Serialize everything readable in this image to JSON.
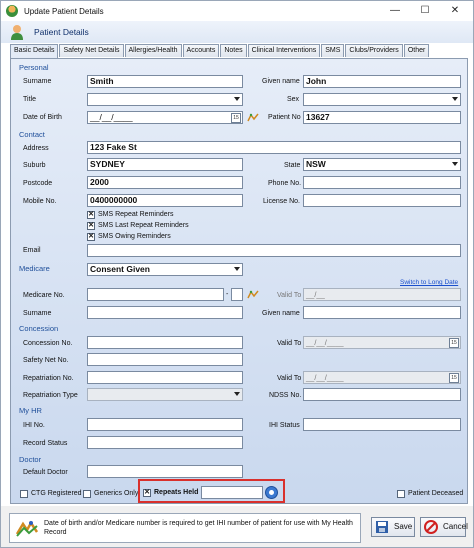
{
  "window": {
    "title": "Update Patient Details",
    "minimize": "—",
    "maximize": "☐",
    "close": "✕"
  },
  "header": {
    "title": "Patient Details"
  },
  "tabs": [
    "Basic Details",
    "Safety Net Details",
    "Allergies/Health",
    "Accounts",
    "Notes",
    "Clinical Interventions",
    "SMS",
    "Clubs/Providers",
    "Other"
  ],
  "personal": {
    "section": "Personal",
    "surname_label": "Surname",
    "surname": "Smith",
    "given_label": "Given name",
    "given": "John",
    "title_label": "Title",
    "title": "",
    "sex_label": "Sex",
    "sex": "",
    "dob_label": "Date of Birth",
    "dob": "__/__/____",
    "patient_no_label": "Patient No",
    "patient_no": "13627"
  },
  "contact": {
    "section": "Contact",
    "address_label": "Address",
    "address": "123 Fake St",
    "suburb_label": "Suburb",
    "suburb": "SYDNEY",
    "state_label": "State",
    "state": "NSW",
    "postcode_label": "Postcode",
    "postcode": "2000",
    "phone_label": "Phone No.",
    "phone": "",
    "mobile_label": "Mobile No.",
    "mobile": "0400000000",
    "license_label": "License No.",
    "license": "",
    "sms_repeat": "SMS Repeat Reminders",
    "sms_last_repeat": "SMS Last Repeat Reminders",
    "sms_owing": "SMS Owing Reminders",
    "email_label": "Email",
    "email": ""
  },
  "medicare": {
    "section": "Medicare",
    "status": "Consent Given",
    "switch_link": "Switch to Long Date",
    "medicare_no_label": "Medicare No.",
    "medicare_no": "",
    "medicare_irn": "",
    "valid_to_label": "Valid To",
    "valid_to": "__/__",
    "surname_label": "Surname",
    "surname": "",
    "given_label": "Given name",
    "given": ""
  },
  "concession": {
    "section": "Concession",
    "concession_no_label": "Concession No.",
    "concession_no": "",
    "valid_to_label": "Valid To",
    "valid_to": "__/__/____",
    "safety_net_label": "Safety Net No.",
    "safety_net": "",
    "repatriation_no_label": "Repatriation No.",
    "repatriation_no": "",
    "rep_valid_to_label": "Valid To",
    "rep_valid_to": "__/__/____",
    "repatriation_type_label": "Repatriation Type",
    "repatriation_type": "",
    "ndss_label": "NDSS No.",
    "ndss": ""
  },
  "myhr": {
    "section": "My HR",
    "ihi_no_label": "IHI No.",
    "ihi_no": "",
    "ihi_status_label": "IHI Status",
    "ihi_status": "",
    "record_status_label": "Record Status",
    "record_status": ""
  },
  "doctor": {
    "section": "Doctor",
    "default_doctor_label": "Default Doctor",
    "default_doctor": ""
  },
  "options": {
    "ctg": "CTG Registered",
    "generics": "Generics Only",
    "repeats_held": "Repeats Held",
    "repeats_held_value": "",
    "deceased": "Patient Deceased"
  },
  "footer": {
    "note": "Date of birth and/or Medicare number is required to get IHI number of patient for use with My Health Record",
    "save": "Save",
    "cancel": "Cancel"
  },
  "colors": {
    "section": "#1f4f9a",
    "highlight": "#d9302c",
    "link": "#1a4fcc"
  }
}
